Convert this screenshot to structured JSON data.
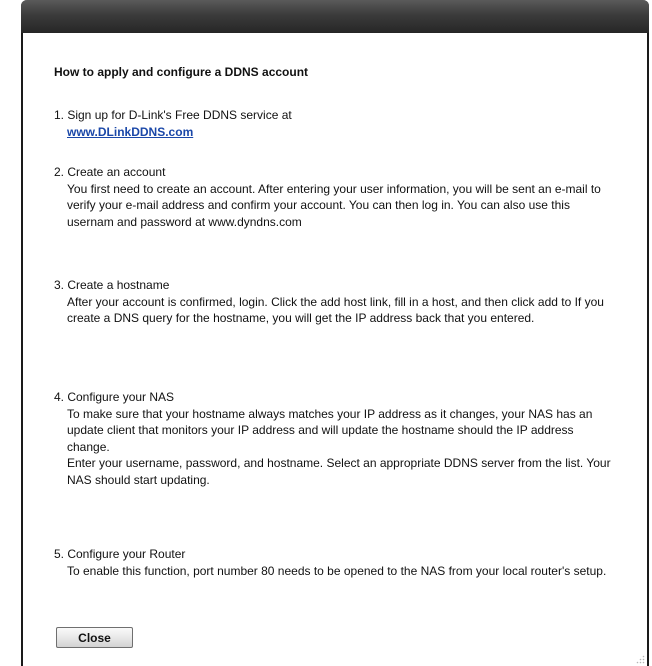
{
  "dialog": {
    "heading": "How to apply and configure a DDNS account",
    "close_label": "Close"
  },
  "steps": [
    {
      "title": "1. Sign up for D-Link's Free DDNS service at",
      "link": "www.DLinkDDNS.com"
    },
    {
      "title": "2. Create an account",
      "body": "You first need to create an account. After entering your user information, you will be sent an e-mail to verify your e-mail address and confirm your account. You can then log in. You can also use this usernam and password at www.dyndns.com"
    },
    {
      "title": "3. Create a hostname",
      "body": "After your account is confirmed, login. Click the add host link, fill in a host, and then click add to If you create a DNS query for the hostname, you will get the IP address back that you entered."
    },
    {
      "title": "4. Configure your NAS",
      "body": "To make sure that your hostname always matches your IP address as it changes, your NAS has an update client that monitors your IP address and will update the hostname should the IP address change.",
      "body2": "Enter your username, password, and hostname. Select an appropriate DDNS server from the list. Your NAS should start updating."
    },
    {
      "title": "5. Configure your Router",
      "body": "To enable this function, port number 80 needs to be opened to the NAS from your local router's setup."
    }
  ]
}
